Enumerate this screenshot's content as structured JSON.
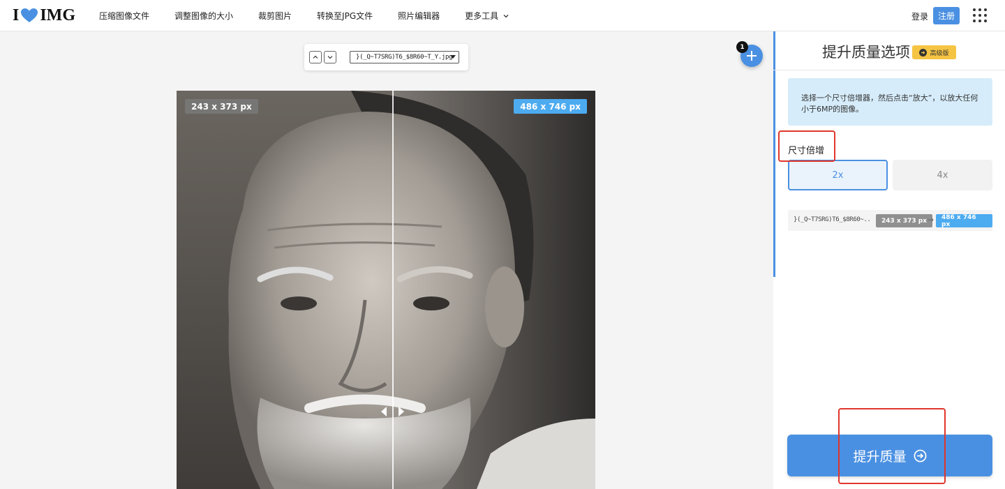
{
  "header": {
    "logo": {
      "left": "I",
      "right": "IMG"
    },
    "nav": [
      {
        "label": "压缩图像文件"
      },
      {
        "label": "调整图像的大小"
      },
      {
        "label": "裁剪图片"
      },
      {
        "label": "转换至JPG文件"
      },
      {
        "label": "照片编辑器"
      },
      {
        "label": "更多工具"
      }
    ],
    "login": "登录",
    "register": "注册"
  },
  "toolbar": {
    "selected_file": "}(_Q~T7SRG)T6_$8R60~T_Y.jpg"
  },
  "add_badge": "1",
  "compare": {
    "left_size": "243 x 373 px",
    "right_size": "486 x 746 px"
  },
  "panel": {
    "title": "提升质量选项",
    "premium": "高级版",
    "info": "选择一个尺寸倍增器，然后点击“放大”，以放大任何小于6MP的图像。",
    "scale_label": "尺寸倍增",
    "scale_options": [
      {
        "label": "2x",
        "selected": true
      },
      {
        "label": "4x",
        "selected": false
      }
    ],
    "file_row": {
      "name": "}(_Q~T7SRG)T6_$8R60~...",
      "src": "243 x 373 px",
      "arrow": "→",
      "dst": "486 x 746 px"
    },
    "action": "提升质量"
  },
  "colors": {
    "accent": "#4a90e2",
    "premium": "#f6c443",
    "annotation": "#e0362b"
  }
}
